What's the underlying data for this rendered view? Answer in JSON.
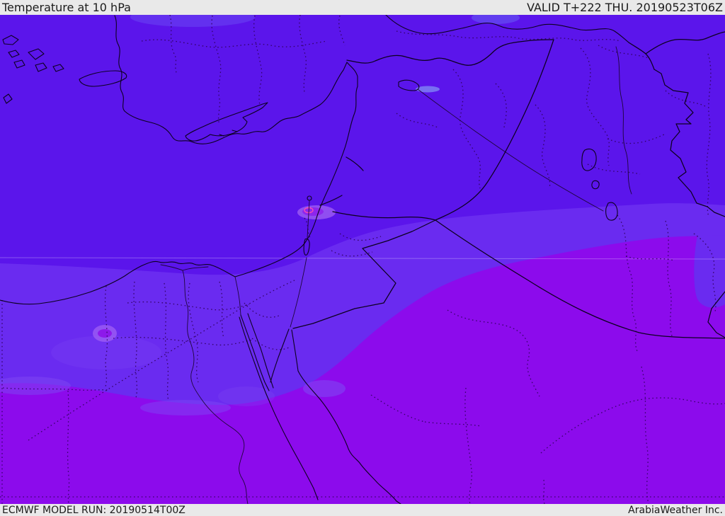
{
  "header": {
    "title": "Temperature at 10 hPa",
    "valid_label": "VALID T+222 THU. 20190523T06Z"
  },
  "footer": {
    "model_run_label": "ECMWF MODEL RUN: 20190514T00Z",
    "brand_label": "ArabiaWeather Inc."
  },
  "map": {
    "description": "ECMWF 10 hPa temperature forecast shading over the Middle East",
    "colors": {
      "bar_background": "#e9e9e9",
      "bar_text": "#1b1b1b",
      "zone_north": "#5b15eb",
      "zone_band": "#6a2bf0",
      "zone_south": "#8c0bec",
      "light_patch": "#7e46f3",
      "ring_outer": "#a767f4",
      "ring_inner_west": "#8d13ea",
      "ring_inner_east": "#8d22ec",
      "hot_spot_pink": "#ff4fae",
      "water_light_blue": "#8fb9f7",
      "top_haze": "#6b4bf4",
      "top_haze_blue": "#6b7df6",
      "line_solid": "#0d0020",
      "line_dotted": "#30005c",
      "river": "#1a0430",
      "gridline": "#ffffff"
    }
  }
}
